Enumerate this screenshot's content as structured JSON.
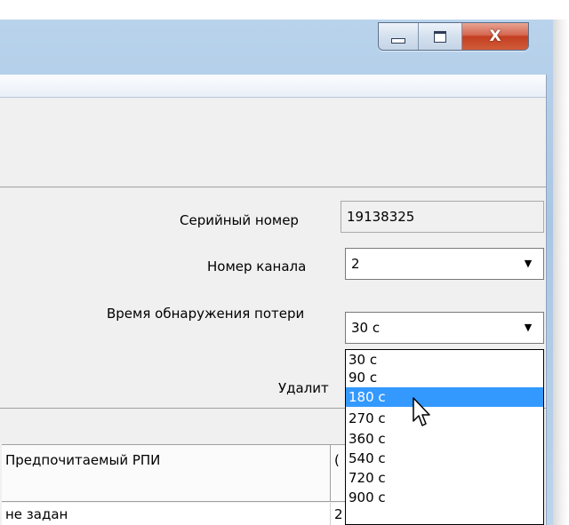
{
  "window": {
    "caption_buttons": [
      {
        "name": "minimize-icon"
      },
      {
        "name": "maximize-icon"
      },
      {
        "name": "close-icon",
        "glyph": "X"
      }
    ]
  },
  "form": {
    "serial_label": "Серийный номер",
    "serial_value": "19138325",
    "channel_label": "Номер канала",
    "channel_value": "2",
    "loss_time_label": "Время обнаружения потери",
    "loss_time_value": "30 с",
    "delete_label_partial": "Удалит"
  },
  "dropdown": {
    "options": [
      "30 с",
      "90 с",
      "180 с",
      "270 с",
      "360 с",
      "540 с",
      "720 с",
      "900 с"
    ],
    "highlighted_index": 2
  },
  "grid": {
    "headers": [
      "Предпочитаемый РПИ",
      "("
    ],
    "rows": [
      [
        "не задан",
        "2"
      ]
    ]
  },
  "colors": {
    "selection": "#3399ff",
    "frame": "#a9c6e4",
    "client": "#f0f0f0"
  }
}
